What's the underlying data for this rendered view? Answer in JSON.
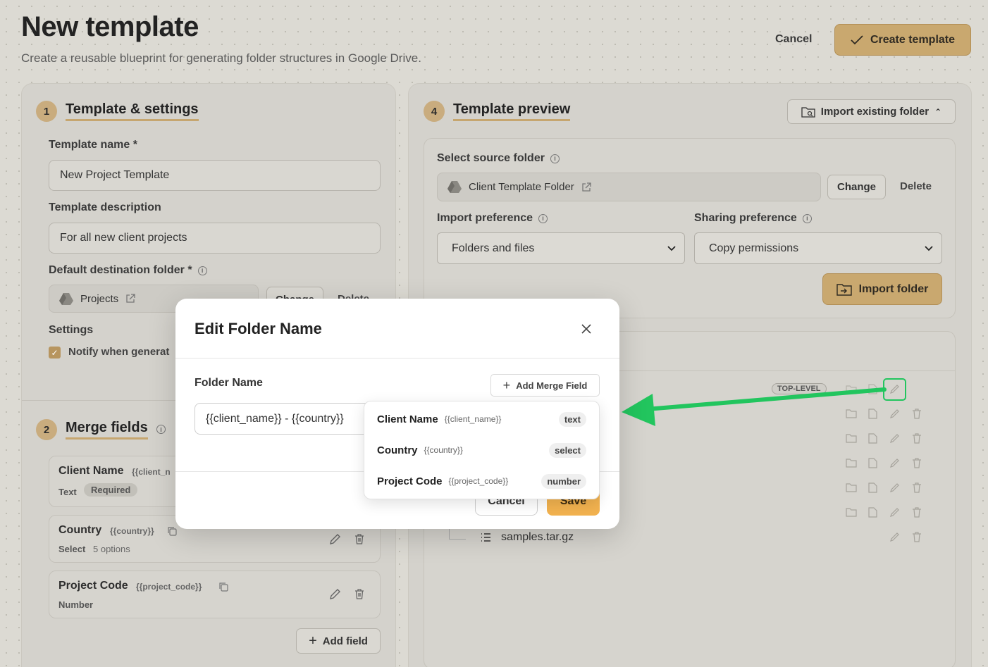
{
  "header": {
    "title": "New template",
    "subtitle": "Create a reusable blueprint for generating folder structures in Google Drive.",
    "cancel_label": "Cancel",
    "create_label": "Create template"
  },
  "left": {
    "step1": "1",
    "section1_title": "Template & settings",
    "template_name_label": "Template name *",
    "template_name_value": "New Project Template",
    "template_desc_label": "Template description",
    "template_desc_value": "For all new client projects",
    "dest_folder_label": "Default destination folder *",
    "dest_folder_name": "Projects",
    "change_label": "Change",
    "delete_label": "Delete",
    "settings_label": "Settings",
    "notify_label": "Notify when generat",
    "step2": "2",
    "section2_title": "Merge fields",
    "merge_fields": [
      {
        "name": "Client Name",
        "token": "{{client_n",
        "type": "Text",
        "badge": "Required"
      },
      {
        "name": "Country",
        "token": "{{country}}",
        "type": "Select",
        "meta": "5 options"
      },
      {
        "name": "Project Code",
        "token": "{{project_code}}",
        "type": "Number"
      }
    ],
    "add_field_label": "Add field"
  },
  "right": {
    "step4": "4",
    "section_title": "Template preview",
    "import_existing_label": "Import existing folder",
    "source_folder_label": "Select source folder",
    "source_folder_name": "Client Template Folder",
    "change_label": "Change",
    "delete_label": "Delete",
    "import_pref_label": "Import preference",
    "import_pref_value": "Folders and files",
    "sharing_pref_label": "Sharing preference",
    "sharing_pref_value": "Copy permissions",
    "import_folder_label": "Import folder",
    "top_level_badge": "TOP-LEVEL",
    "tree_file": "samples.tar.gz"
  },
  "modal": {
    "title": "Edit Folder Name",
    "field_label": "Folder Name",
    "add_merge_label": "Add Merge Field",
    "input_value": "{{client_name}} - {{country}}",
    "cancel_label": "Cancel",
    "save_label": "Save",
    "dropdown": [
      {
        "name": "Client Name",
        "token": "{{client_name}}",
        "type": "text"
      },
      {
        "name": "Country",
        "token": "{{country}}",
        "type": "select"
      },
      {
        "name": "Project Code",
        "token": "{{project_code}}",
        "type": "number"
      }
    ]
  },
  "colors": {
    "accent": "#c9a86f",
    "save_button": "#f2b24f",
    "highlight_arrow": "#22c55e"
  }
}
